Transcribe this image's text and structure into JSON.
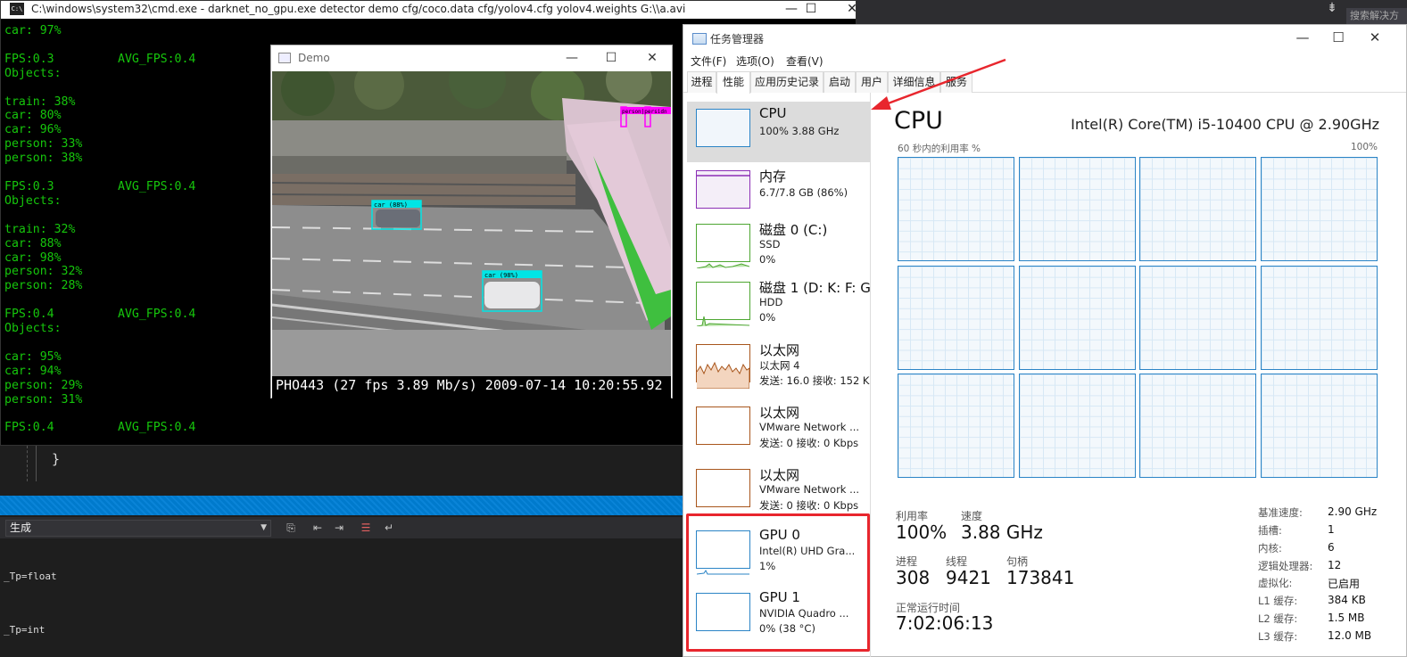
{
  "vs": {
    "search_text": "搜索解决方",
    "brace": "}",
    "output_source": "生成",
    "output_lines": [
      "_Tp=float",
      "_Tp=int"
    ],
    "right_icon": "⇟"
  },
  "cmd": {
    "title": "C:\\windows\\system32\\cmd.exe - darknet_no_gpu.exe  detector demo cfg/coco.data  cfg/yolov4.cfg yolov4.weights G:\\\\a.avi",
    "icon_text": "C:\\",
    "lines": "car: 97%\n\nFPS:0.3         AVG_FPS:0.4\nObjects:\n\ntrain: 38%\ncar: 80%\ncar: 96%\nperson: 33%\nperson: 38%\n\nFPS:0.3         AVG_FPS:0.4\nObjects:\n\ntrain: 32%\ncar: 88%\ncar: 98%\nperson: 32%\nperson: 28%\n\nFPS:0.4         AVG_FPS:0.4\nObjects:\n\ncar: 95%\ncar: 94%\nperson: 29%\nperson: 31%\n\nFPS:0.4         AVG_FPS:0.4"
  },
  "demo": {
    "title": "Demo",
    "osd": "PHO443 (27 fps  3.89 Mb/s) 2009-07-14 10:20:55.92",
    "detections": [
      {
        "label": "car (98%)",
        "color": "#00e5e5"
      },
      {
        "label": "car (88%)",
        "color": "#00e5e5"
      },
      {
        "label": "person|persidn",
        "color": "#ff00ff"
      }
    ]
  },
  "taskmgr": {
    "title": "任务管理器",
    "menu": [
      "文件(F)",
      "选项(O)",
      "查看(V)"
    ],
    "tabs": [
      "进程",
      "性能",
      "应用历史记录",
      "启动",
      "用户",
      "详细信息",
      "服务"
    ],
    "active_tab": "性能",
    "sidebar": [
      {
        "name": "CPU",
        "line1": "100% 3.88 GHz",
        "line2": "",
        "color": "#2b84c6"
      },
      {
        "name": "内存",
        "line1": "6.7/7.8 GB (86%)",
        "line2": "",
        "color": "#8b2fb5"
      },
      {
        "name": "磁盘 0 (C:)",
        "line1": "SSD",
        "line2": "0%",
        "color": "#4da631"
      },
      {
        "name": "磁盘 1 (D: K: F: G",
        "line1": "HDD",
        "line2": "0%",
        "color": "#4da631"
      },
      {
        "name": "以太网",
        "line1": "以太网 4",
        "line2": "发送: 16.0  接收: 152 K",
        "color": "#a8561c"
      },
      {
        "name": "以太网",
        "line1": "VMware Network ...",
        "line2": "发送: 0  接收: 0 Kbps",
        "color": "#a8561c"
      },
      {
        "name": "以太网",
        "line1": "VMware Network ...",
        "line2": "发送: 0  接收: 0 Kbps",
        "color": "#a8561c"
      },
      {
        "name": "GPU 0",
        "line1": "Intel(R) UHD Gra...",
        "line2": "1%",
        "color": "#2b84c6"
      },
      {
        "name": "GPU 1",
        "line1": "NVIDIA Quadro ...",
        "line2": "0% (38 °C)",
        "color": "#2b84c6"
      }
    ],
    "cpu": {
      "title": "CPU",
      "model": "Intel(R) Core(TM) i5-10400 CPU @ 2.90GHz",
      "util_label": "60 秒内的利用率 %",
      "util_max": "100%",
      "stats": {
        "util_label": "利用率",
        "util": "100%",
        "speed_label": "速度",
        "speed": "3.88 GHz",
        "proc_label": "进程",
        "proc": "308",
        "thread_label": "线程",
        "thread": "9421",
        "handle_label": "句柄",
        "handle": "173841",
        "uptime_label": "正常运行时间",
        "uptime": "7:02:06:13"
      },
      "details": [
        {
          "label": "基准速度:",
          "value": "2.90 GHz"
        },
        {
          "label": "插槽:",
          "value": "1"
        },
        {
          "label": "内核:",
          "value": "6"
        },
        {
          "label": "逻辑处理器:",
          "value": "12"
        },
        {
          "label": "虚拟化:",
          "value": "已启用"
        },
        {
          "label": "L1 缓存:",
          "value": "384 KB"
        },
        {
          "label": "L2 缓存:",
          "value": "1.5 MB"
        },
        {
          "label": "L3 缓存:",
          "value": "12.0 MB"
        }
      ]
    }
  },
  "colors": {
    "highlight": "#e8262d",
    "console_text": "#16c60c",
    "accent": "#2b84c6"
  }
}
